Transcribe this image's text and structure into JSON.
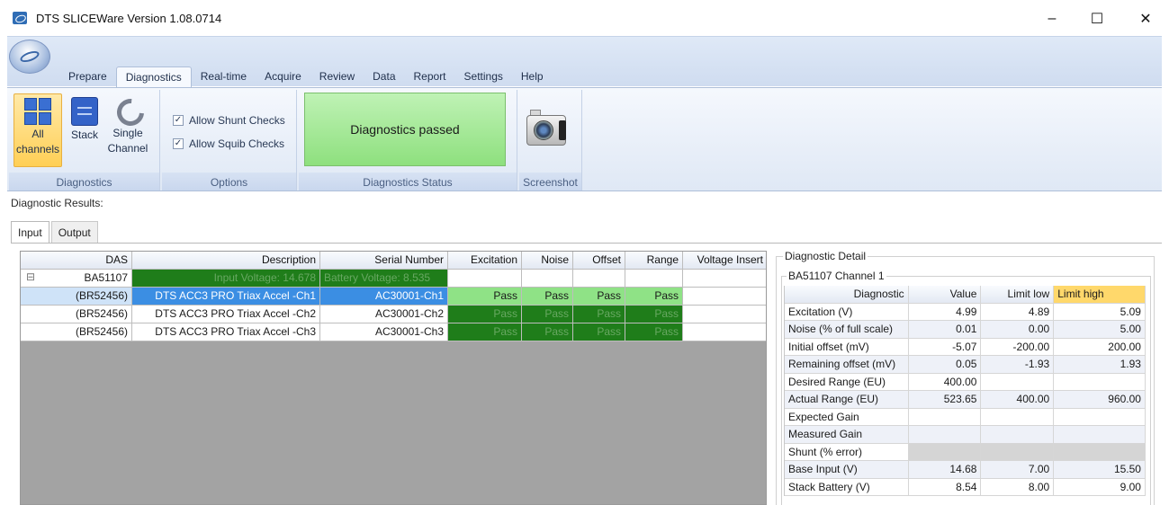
{
  "window": {
    "title": "DTS SLICEWare Version 1.08.0714",
    "minimize": "–",
    "maximize": "☐",
    "close": "✕"
  },
  "menu_tabs": [
    "Prepare",
    "Diagnostics",
    "Real-time",
    "Acquire",
    "Review",
    "Data",
    "Report",
    "Settings",
    "Help"
  ],
  "ribbon": {
    "diagnostics_group": {
      "label": "Diagnostics",
      "all_channels": [
        "All",
        "channels"
      ],
      "stack": "Stack",
      "single_channel": [
        "Single",
        "Channel"
      ]
    },
    "options_group": {
      "label": "Options",
      "allow_shunt": "Allow Shunt Checks",
      "allow_squib": "Allow Squib Checks",
      "check_mark": "✓"
    },
    "status_group": {
      "label": "Diagnostics Status",
      "status": "Diagnostics passed"
    },
    "screenshot_group": {
      "label": "Screenshot"
    }
  },
  "results": {
    "label": "Diagnostic Results:",
    "tabs": [
      "Input",
      "Output"
    ],
    "columns": [
      "DAS",
      "Description",
      "Serial Number",
      "Excitation",
      "Noise",
      "Offset",
      "Range",
      "Voltage Insert"
    ],
    "das_row": {
      "das": "BA51107",
      "description": "Input Voltage: 14.678",
      "serial": "Battery Voltage: 8.535",
      "expand": "⊟"
    },
    "rows": [
      {
        "das": "(BR52456)",
        "description": "DTS ACC3 PRO Triax Accel -Ch1",
        "serial": "AC30001-Ch1",
        "excitation": "Pass",
        "noise": "Pass",
        "offset": "Pass",
        "range": "Pass"
      },
      {
        "das": "(BR52456)",
        "description": "DTS ACC3 PRO Triax Accel -Ch2",
        "serial": "AC30001-Ch2",
        "excitation": "Pass",
        "noise": "Pass",
        "offset": "Pass",
        "range": "Pass"
      },
      {
        "das": "(BR52456)",
        "description": "DTS ACC3 PRO Triax Accel -Ch3",
        "serial": "AC30001-Ch3",
        "excitation": "Pass",
        "noise": "Pass",
        "offset": "Pass",
        "range": "Pass"
      }
    ]
  },
  "detail": {
    "title": "Diagnostic Detail",
    "channel": "BA51107 Channel 1",
    "columns": [
      "Diagnostic",
      "Value",
      "Limit low",
      "Limit high"
    ],
    "rows": [
      [
        "Excitation (V)",
        "4.99",
        "4.89",
        "5.09"
      ],
      [
        "Noise (% of full scale)",
        "0.01",
        "0.00",
        "5.00"
      ],
      [
        "Initial offset (mV)",
        "-5.07",
        "-200.00",
        "200.00"
      ],
      [
        "Remaining offset (mV)",
        "0.05",
        "-1.93",
        "1.93"
      ],
      [
        "Desired Range (EU)",
        "400.00",
        "",
        ""
      ],
      [
        "Actual Range (EU)",
        "523.65",
        "400.00",
        "960.00"
      ],
      [
        "Expected Gain",
        "",
        "",
        ""
      ],
      [
        "Measured Gain",
        "",
        "",
        ""
      ],
      [
        "Shunt (% error)",
        "",
        "",
        ""
      ],
      [
        "Base Input (V)",
        "14.68",
        "7.00",
        "15.50"
      ],
      [
        "Stack Battery (V)",
        "8.54",
        "8.00",
        "9.00"
      ]
    ]
  }
}
